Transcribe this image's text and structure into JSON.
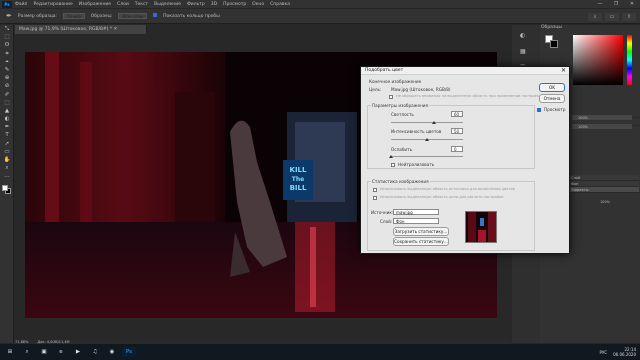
{
  "menu": {
    "logo": "Ps",
    "items": [
      "Файл",
      "Редактирование",
      "Изображение",
      "Слои",
      "Текст",
      "Выделение",
      "Фильтр",
      "3D",
      "Просмотр",
      "Окно",
      "Справка"
    ],
    "window_controls": [
      "—",
      "❐",
      "✕"
    ]
  },
  "options": {
    "tool_icon": "eyedropper-icon",
    "size_label": "Размер образца:",
    "size_value": "Точка",
    "sample_label": "Образец:",
    "sample_value": "Все слои",
    "ring_label": "Показать кольцо пробы"
  },
  "tab": {
    "title": "Maw.jpg @ 71,9% (Штоковое, RGB/8#) * ✕"
  },
  "status": {
    "zoom": "71,88%",
    "doc": "Док: 4,00М/11,4М"
  },
  "tools": [
    "⤡",
    "⬚",
    "ʘ",
    "⌗",
    "⌖",
    "✎",
    "⊕",
    "⊘",
    "✐",
    "⬚",
    "▲",
    "◐",
    "✒",
    "T",
    "➚",
    "▭",
    "✋",
    "⌕",
    "…"
  ],
  "color_panel": {
    "title": "Образцы",
    "foreground": "#ffffff",
    "background": "#000000",
    "accent": "#ff0000"
  },
  "dialog": {
    "title": "Подобрать цвет",
    "target_header": "Конечное изображение",
    "target_label": "Цель:",
    "target_value": "Maw.jpg (Штоковое, RGB/8)",
    "ignore_sel": "Не обращать внимания на выделенную область при применении настроек",
    "options_header": "Параметры изображения",
    "luminance_label": "Светлость",
    "luminance_value": "60",
    "intensity_label": "Интенсивность цветов",
    "intensity_value": "50",
    "fade_label": "Ослабить",
    "fade_value": "0",
    "neutralize_label": "Нейтрализовать",
    "stats_header": "Статистика изображения",
    "use_sel_source": "Использовать выделенную область источника для вычисления цветов",
    "use_sel_target": "Использовать выделенную область цели для расчета настройки",
    "source_label": "Источник:",
    "source_value": "maw.jpg",
    "layer_label": "Слой:",
    "layer_value": "Фон",
    "load_button": "Загрузить статистику...",
    "save_button": "Сохранить статистику...",
    "ok": "OK",
    "cancel": "Отмена",
    "preview": "Просмотр",
    "luminance_frac": 0.6,
    "intensity_frac": 0.5,
    "fade_frac": 0.0
  },
  "layers": {
    "rows": [
      "Слой",
      "Фон",
      "Эффекты"
    ],
    "side_labels": [
      "100%",
      "100%",
      "100%"
    ]
  },
  "photo": {
    "sign_line1": "KILL",
    "sign_line2": "The",
    "sign_line3": "BILL"
  },
  "taskbar": {
    "icons": [
      "⊞",
      "⌕",
      "▣",
      "e",
      "▶",
      "♫",
      "◉",
      "Ps"
    ],
    "time": "22:14",
    "date": "06.06.2020",
    "lang": "РУС"
  }
}
